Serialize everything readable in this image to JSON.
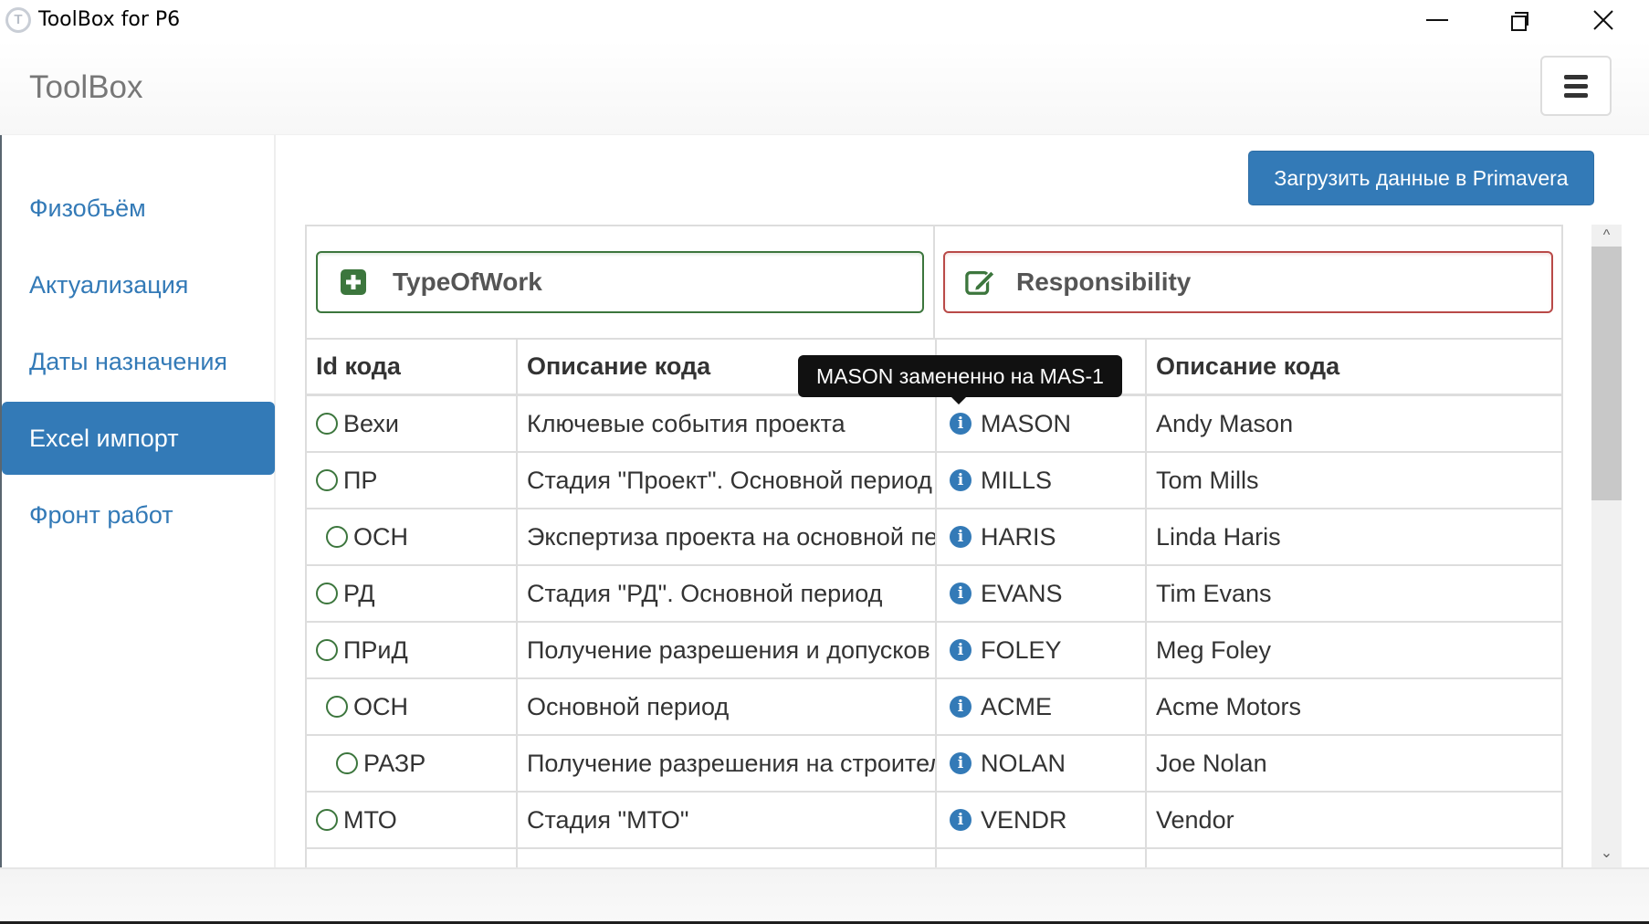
{
  "window": {
    "title": "ToolBox for P6",
    "icon": "toolbox-gear-icon",
    "icon_letter": "T",
    "controls": {
      "minimize": "minimize-icon",
      "maximize": "restore-icon",
      "close": "close-icon"
    }
  },
  "navbar": {
    "brand": "ToolBox",
    "menu_icon": "hamburger-icon"
  },
  "sidebar": {
    "items": [
      {
        "label": "Физобъём",
        "active": false
      },
      {
        "label": "Актуализация",
        "active": false
      },
      {
        "label": "Даты назначения",
        "active": false
      },
      {
        "label": "Excel импорт",
        "active": true
      },
      {
        "label": "Фронт работ",
        "active": false
      }
    ]
  },
  "toolbar": {
    "upload_label": "Загрузить данные в Primavera"
  },
  "panels": {
    "left": {
      "title": "TypeOfWork",
      "icon": "plus-square-icon",
      "border_color": "#3c763d"
    },
    "right": {
      "title": "Responsibility",
      "icon": "edit-icon",
      "border_color": "#b94a48"
    }
  },
  "table": {
    "headers": [
      "Id кода",
      "Описание кода",
      "Id кода",
      "Описание кода"
    ],
    "left_rows": [
      {
        "id": "Вехи",
        "level": 0,
        "description": "Ключевые события проекта"
      },
      {
        "id": "ПР",
        "level": 0,
        "description": "Стадия \"Проект\". Основной период"
      },
      {
        "id": "ОСН",
        "level": 1,
        "description": "Экспертиза проекта на основной период"
      },
      {
        "id": "РД",
        "level": 0,
        "description": "Стадия \"РД\". Основной период"
      },
      {
        "id": "ПРиД",
        "level": 0,
        "description": "Получение разрешения и допусков"
      },
      {
        "id": "ОСН",
        "level": 1,
        "description": "Основной период"
      },
      {
        "id": "РАЗР",
        "level": 2,
        "description": "Получение разрешения на строительство"
      },
      {
        "id": "МТО",
        "level": 0,
        "description": "Стадия \"МТО\""
      }
    ],
    "right_rows": [
      {
        "id": "MASON",
        "description": "Andy Mason"
      },
      {
        "id": "MILLS",
        "description": "Tom Mills"
      },
      {
        "id": "HARIS",
        "description": "Linda Haris"
      },
      {
        "id": "EVANS",
        "description": "Tim Evans"
      },
      {
        "id": "FOLEY",
        "description": "Meg Foley"
      },
      {
        "id": "ACME",
        "description": "Acme Motors"
      },
      {
        "id": "NOLAN",
        "description": "Joe Nolan"
      },
      {
        "id": "VENDR",
        "description": "Vendor"
      }
    ],
    "row_icon_left": "radio-circle-icon",
    "row_icon_right": "info-circle-icon"
  },
  "tooltip": {
    "text": "MASON замененно на MAS-1"
  },
  "colors": {
    "primary": "#337ab7",
    "success": "#3c763d",
    "danger": "#b94a48"
  }
}
